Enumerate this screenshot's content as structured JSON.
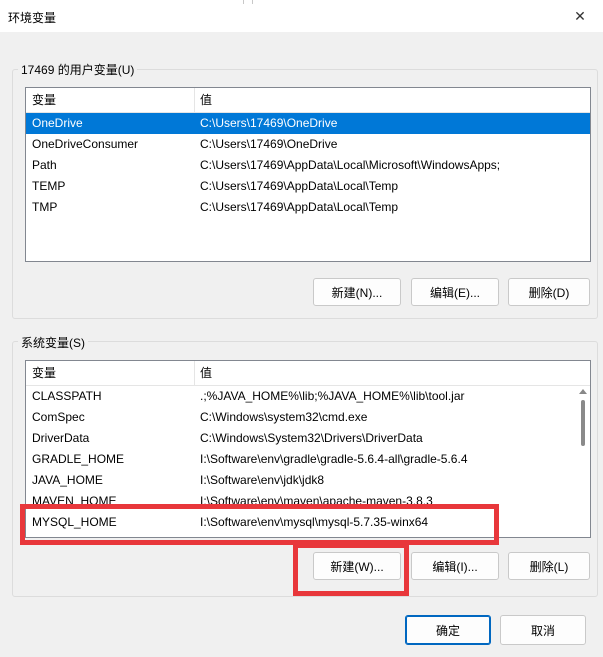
{
  "window": {
    "title": "环境变量"
  },
  "user_vars": {
    "group_label": "17469 的用户变量(U)",
    "columns": [
      "变量",
      "值"
    ],
    "rows": [
      {
        "name": "OneDrive",
        "value": "C:\\Users\\17469\\OneDrive",
        "selected": true
      },
      {
        "name": "OneDriveConsumer",
        "value": "C:\\Users\\17469\\OneDrive"
      },
      {
        "name": "Path",
        "value": "C:\\Users\\17469\\AppData\\Local\\Microsoft\\WindowsApps;"
      },
      {
        "name": "TEMP",
        "value": "C:\\Users\\17469\\AppData\\Local\\Temp"
      },
      {
        "name": "TMP",
        "value": "C:\\Users\\17469\\AppData\\Local\\Temp"
      }
    ],
    "buttons": {
      "new": "新建(N)...",
      "edit": "编辑(E)...",
      "delete": "删除(D)"
    }
  },
  "system_vars": {
    "group_label": "系统变量(S)",
    "columns": [
      "变量",
      "值"
    ],
    "rows": [
      {
        "name": "CLASSPATH",
        "value": ".;%JAVA_HOME%\\lib;%JAVA_HOME%\\lib\\tool.jar"
      },
      {
        "name": "ComSpec",
        "value": "C:\\Windows\\system32\\cmd.exe"
      },
      {
        "name": "DriverData",
        "value": "C:\\Windows\\System32\\Drivers\\DriverData"
      },
      {
        "name": "GRADLE_HOME",
        "value": "I:\\Software\\env\\gradle\\gradle-5.6.4-all\\gradle-5.6.4"
      },
      {
        "name": "JAVA_HOME",
        "value": "I:\\Software\\env\\jdk\\jdk8"
      },
      {
        "name": "MAVEN_HOME",
        "value": "I:\\Software\\env\\maven\\apache-maven-3.8.3"
      },
      {
        "name": "MYSQL_HOME",
        "value": "I:\\Software\\env\\mysql\\mysql-5.7.35-winx64"
      }
    ],
    "buttons": {
      "new": "新建(W)...",
      "edit": "编辑(I)...",
      "delete": "删除(L)"
    }
  },
  "footer": {
    "ok": "确定",
    "cancel": "取消"
  },
  "annotation_color": "#e8373b",
  "selection_color": "#0078d7"
}
